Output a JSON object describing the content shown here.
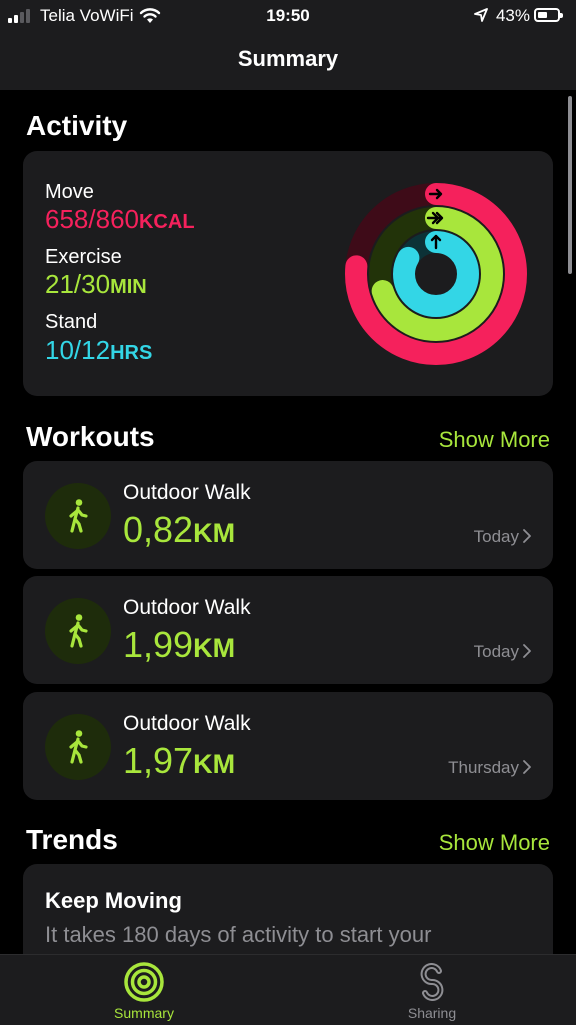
{
  "status_bar": {
    "carrier": "Telia VoWiFi",
    "time": "19:50",
    "battery": "43%"
  },
  "nav": {
    "title": "Summary"
  },
  "activity": {
    "section_title": "Activity",
    "move": {
      "label": "Move",
      "value": "658/860",
      "unit": "KCAL",
      "progress": 0.765,
      "color": "#f5215c"
    },
    "exercise": {
      "label": "Exercise",
      "value": "21/30",
      "unit": "MIN",
      "progress": 0.7,
      "color": "#a8e63c"
    },
    "stand": {
      "label": "Stand",
      "value": "10/12",
      "unit": "HRS",
      "progress": 0.833,
      "color": "#33d6e6"
    }
  },
  "workouts": {
    "section_title": "Workouts",
    "show_more": "Show More",
    "items": [
      {
        "name": "Outdoor Walk",
        "value": "0,82",
        "unit": "KM",
        "date": "Today",
        "icon": "walking-figure-icon"
      },
      {
        "name": "Outdoor Walk",
        "value": "1,99",
        "unit": "KM",
        "date": "Today",
        "icon": "walking-figure-icon"
      },
      {
        "name": "Outdoor Walk",
        "value": "1,97",
        "unit": "KM",
        "date": "Thursday",
        "icon": "walking-figure-icon"
      }
    ]
  },
  "trends": {
    "section_title": "Trends",
    "show_more": "Show More",
    "card_title": "Keep Moving",
    "card_text": "It takes 180 days of activity to start your"
  },
  "tabbar": {
    "summary": {
      "label": "Summary",
      "icon": "activity-rings-icon"
    },
    "sharing": {
      "label": "Sharing",
      "icon": "sharing-icon"
    }
  },
  "colors": {
    "accent": "#a8e63c",
    "move": "#f5215c",
    "stand": "#33d6e6"
  }
}
